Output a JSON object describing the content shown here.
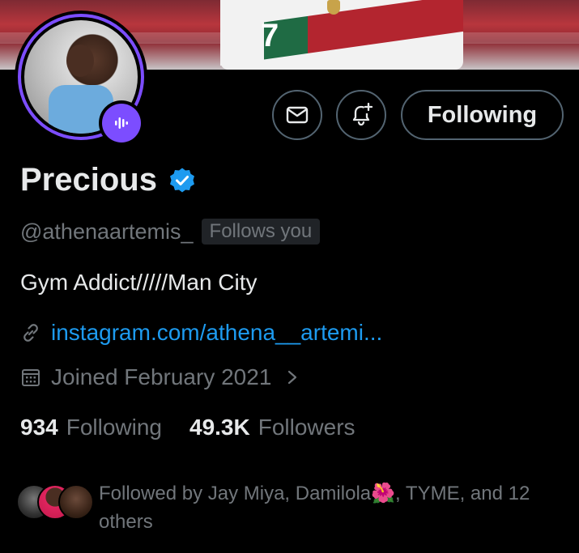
{
  "profile": {
    "name": "Precious",
    "handle": "@athenaartemis_",
    "follows_you_label": "Follows you",
    "bio": "Gym Addict/////Man City",
    "link": "instagram.com/athena__artemi...",
    "joined": "Joined February 2021",
    "following_count": "934",
    "following_label": "Following",
    "followers_count": "49.3K",
    "followers_label": "Followers",
    "banner_number": "7"
  },
  "actions": {
    "message_icon": "mail-icon",
    "notify_icon": "bell-plus-icon",
    "follow_label": "Following"
  },
  "followed_by": {
    "prefix": "Followed by Jay Miya, Damilola",
    "emoji": "🌺",
    "suffix": ", TYME, and 12 others"
  },
  "colors": {
    "accent": "#1d9bf0",
    "spaces_purple": "#7c4dff",
    "muted": "#71767b",
    "border": "#536471"
  }
}
